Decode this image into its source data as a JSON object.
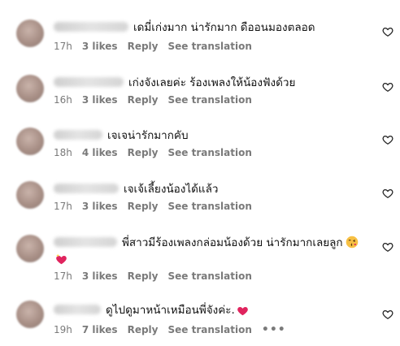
{
  "comments": [
    {
      "text": "เดมี่เก่งมาก น่ารักมาก ดืออนมองตลอด",
      "time": "17h",
      "likes": "3 likes",
      "reply": "Reply",
      "translate": "See translation"
    },
    {
      "text": "เก่งจังเลยค่ะ ร้องเพลงให้น้องฟังด้วย",
      "time": "16h",
      "likes": "3 likes",
      "reply": "Reply",
      "translate": "See translation"
    },
    {
      "text": "เจเจน่ารักมากคับ",
      "time": "18h",
      "likes": "4 likes",
      "reply": "Reply",
      "translate": "See translation"
    },
    {
      "text": "เจเจ้เลี้ยงน้องได้แล้ว",
      "time": "17h",
      "likes": "3 likes",
      "reply": "Reply",
      "translate": "See translation"
    },
    {
      "text": "พี่สาวมีร้องเพลงกล่อมน้องด้วย น่ารักมากเลยลูก",
      "time": "17h",
      "likes": "3 likes",
      "reply": "Reply",
      "translate": "See translation"
    },
    {
      "text": "ดูไปดูมาหน้าเหมือนพี่จังค่ะ.",
      "time": "19h",
      "likes": "7 likes",
      "reply": "Reply",
      "translate": "See translation",
      "more": "•••"
    }
  ],
  "colors": {
    "heart_emoji": "#e0245e",
    "meta_text": "#7a7a7a",
    "face_emoji": "#f7c043"
  },
  "icons": {
    "like": "heart-outline-icon",
    "emoji_heart": "red-heart-icon",
    "emoji_face": "kissing-face-icon",
    "more": "more-options-icon"
  }
}
